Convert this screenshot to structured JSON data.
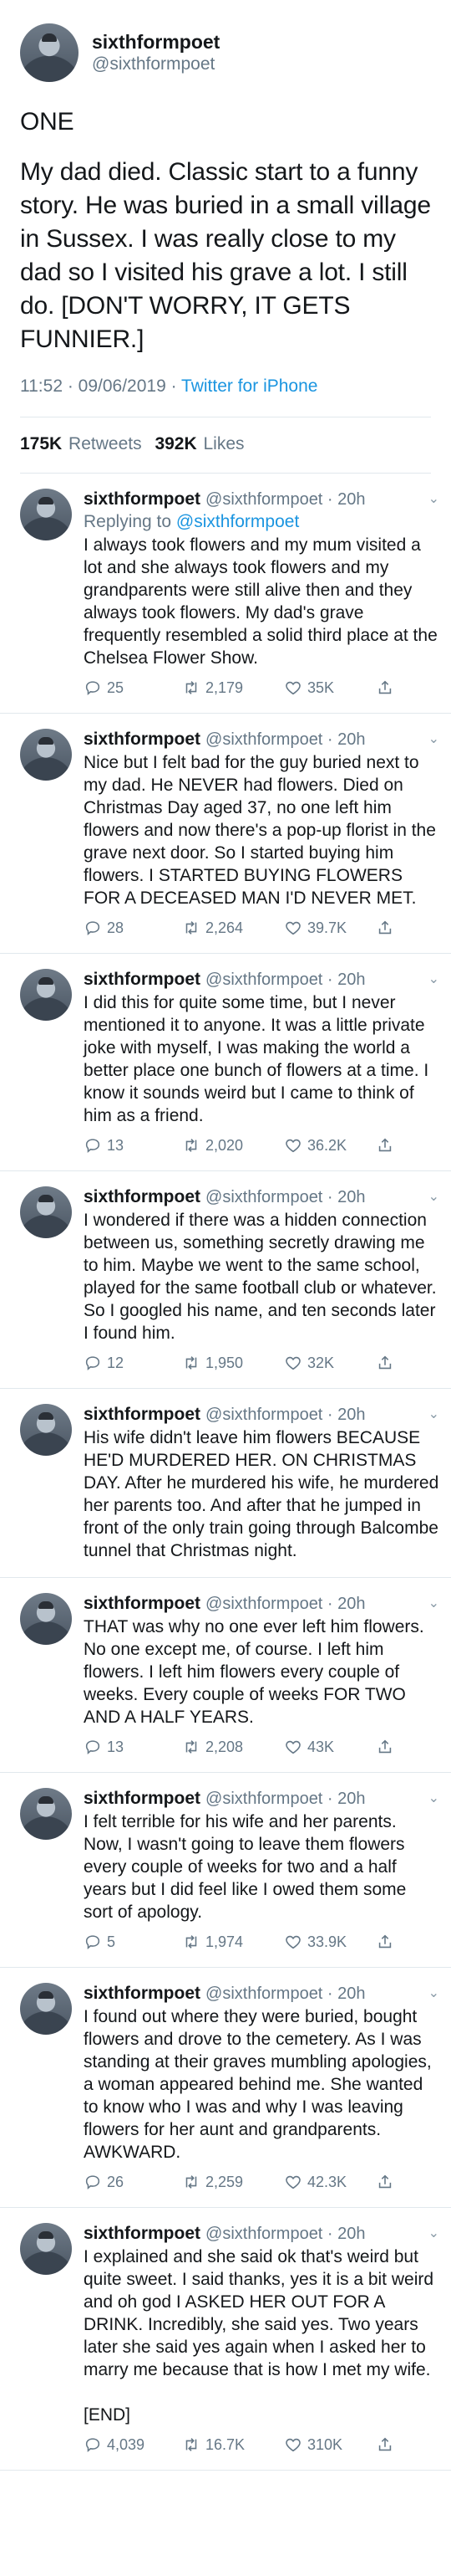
{
  "author": {
    "display_name": "sixthformpoet",
    "handle": "@sixthformpoet"
  },
  "main_tweet": {
    "paragraphs": [
      "ONE",
      "My dad died. Classic start to a funny story. He was buried in a small village in Sussex. I was really close to my dad so I visited his grave a lot. I still do. [DON'T WORRY, IT GETS FUNNIER.]"
    ],
    "time": "11:52 · 09/06/2019 · ",
    "source": "Twitter for iPhone",
    "retweets_count": "175K",
    "retweets_label": "Retweets",
    "likes_count": "392K",
    "likes_label": "Likes"
  },
  "replies": [
    {
      "display_name": "sixthformpoet",
      "handle": "@sixthformpoet · 20h",
      "replying_prefix": "Replying to ",
      "replying_to": "@sixthformpoet",
      "text": "I always took flowers and my mum visited a lot and she always took flowers and my grandparents were still alive then and they always took flowers. My dad's grave frequently resembled a solid third place at the Chelsea Flower Show.",
      "replies": "25",
      "retweets": "2,179",
      "likes": "35K"
    },
    {
      "display_name": "sixthformpoet",
      "handle": "@sixthformpoet · 20h",
      "text": "Nice but I felt bad for the guy buried next to my dad. He NEVER had flowers. Died on Christmas Day aged 37, no one left him flowers and now there's a pop-up florist in the grave next door. So I started buying him flowers. I STARTED BUYING FLOWERS FOR A DECEASED MAN I'D NEVER MET.",
      "replies": "28",
      "retweets": "2,264",
      "likes": "39.7K"
    },
    {
      "display_name": "sixthformpoet",
      "handle": "@sixthformpoet · 20h",
      "text": "I did this for quite some time, but I never mentioned it to anyone. It was a little private joke with myself, I was making the world a better place one bunch of flowers at a time. I know it sounds weird but I came to think of him as a friend.",
      "replies": "13",
      "retweets": "2,020",
      "likes": "36.2K"
    },
    {
      "display_name": "sixthformpoet",
      "handle": "@sixthformpoet · 20h",
      "text": "I wondered if there was a hidden connection between us, something secretly drawing me to him. Maybe we went to the same school, played for the same football club or whatever. So I googled his name, and ten seconds later I found him.",
      "replies": "12",
      "retweets": "1,950",
      "likes": "32K"
    },
    {
      "display_name": "sixthformpoet",
      "handle": "@sixthformpoet · 20h",
      "text": "His wife didn't leave him flowers BECAUSE HE'D MURDERED HER. ON CHRISTMAS DAY. After he murdered his wife, he murdered her parents too. And after that he jumped in front of the only train going through Balcombe tunnel that Christmas night.",
      "replies": "",
      "retweets": "",
      "likes": ""
    },
    {
      "display_name": "sixthformpoet",
      "handle": "@sixthformpoet · 20h",
      "text": "THAT was why no one ever left him flowers. No one except me, of course. I left him flowers. I left him flowers every couple of weeks. Every couple of weeks FOR TWO AND A HALF YEARS.",
      "replies": "13",
      "retweets": "2,208",
      "likes": "43K"
    },
    {
      "display_name": "sixthformpoet",
      "handle": "@sixthformpoet · 20h",
      "text": "I felt terrible for his wife and her parents. Now, I wasn't going to leave them flowers every couple of weeks for two and a half years but I did feel like I owed them some sort of apology.",
      "replies": "5",
      "retweets": "1,974",
      "likes": "33.9K"
    },
    {
      "display_name": "sixthformpoet",
      "handle": "@sixthformpoet · 20h",
      "text": "I found out where they were buried, bought flowers and drove to the cemetery. As I was standing at their graves mumbling apologies, a woman appeared behind me. She wanted to know who I was and why I was leaving flowers for her aunt and grandparents. AWKWARD.",
      "replies": "26",
      "retweets": "2,259",
      "likes": "42.3K"
    },
    {
      "display_name": "sixthformpoet",
      "handle": "@sixthformpoet · 20h",
      "text": "I explained and she said ok that's weird but quite sweet. I said thanks, yes it is a bit weird and oh god I ASKED HER OUT FOR A DRINK. Incredibly, she said yes. Two years later she said yes again when I asked her to marry me because that is how I met my wife.",
      "end": "[END]",
      "replies": "4,039",
      "retweets": "16.7K",
      "likes": "310K"
    }
  ]
}
